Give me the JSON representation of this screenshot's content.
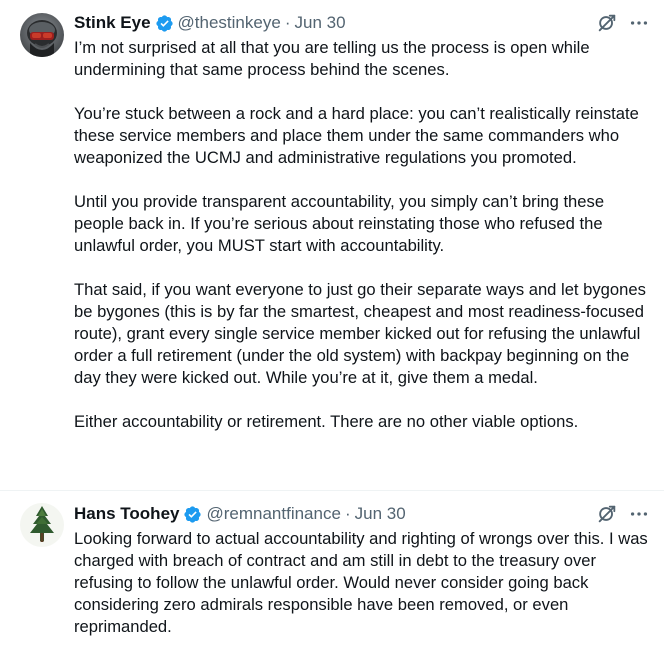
{
  "tweets": [
    {
      "author_name": "Stink Eye",
      "handle": "@thestinkeye",
      "separator": "·",
      "date": "Jun 30",
      "verified": true,
      "avatar_icon": "pilot-helmet-avatar",
      "paragraphs": [
        "I’m not surprised at all that you are telling us the process is open while undermining that same process behind the scenes.",
        "You’re stuck between a rock and a hard place:  you can’t realistically reinstate these service members and place them under the same commanders who weaponized the UCMJ and administrative regulations you promoted.",
        "Until you provide transparent accountability, you simply can’t bring these people back in.  If you’re serious about reinstating those who refused the unlawful order, you MUST start with accountability.",
        "That said, if you want everyone to just go their separate ways and let bygones be bygones (this is by far the smartest, cheapest and most readiness-focused route), grant every single service member kicked out for refusing the unlawful order a full retirement (under the old system) with backpay beginning on the day they were kicked out.  While you’re at it, give them a medal.",
        "Either accountability or retirement.  There are no other viable options."
      ]
    },
    {
      "author_name": "Hans Toohey",
      "handle": "@remnantfinance",
      "separator": "·",
      "date": "Jun 30",
      "verified": true,
      "avatar_icon": "pine-tree-avatar",
      "paragraphs": [
        "Looking forward to actual accountability and righting of wrongs over this. I was charged with breach of contract and am still in debt to the treasury over refusing to follow the unlawful order. Would never consider going back considering zero admirals responsible have been removed, or even reprimanded."
      ]
    }
  ],
  "icons": {
    "verified": "verified-badge-icon",
    "grok": "grok-icon",
    "more": "more-options-icon"
  },
  "colors": {
    "verified_blue": "#1d9bf0",
    "secondary_text": "#536471",
    "primary_text": "#0f1419",
    "divider": "#eff3f4"
  }
}
